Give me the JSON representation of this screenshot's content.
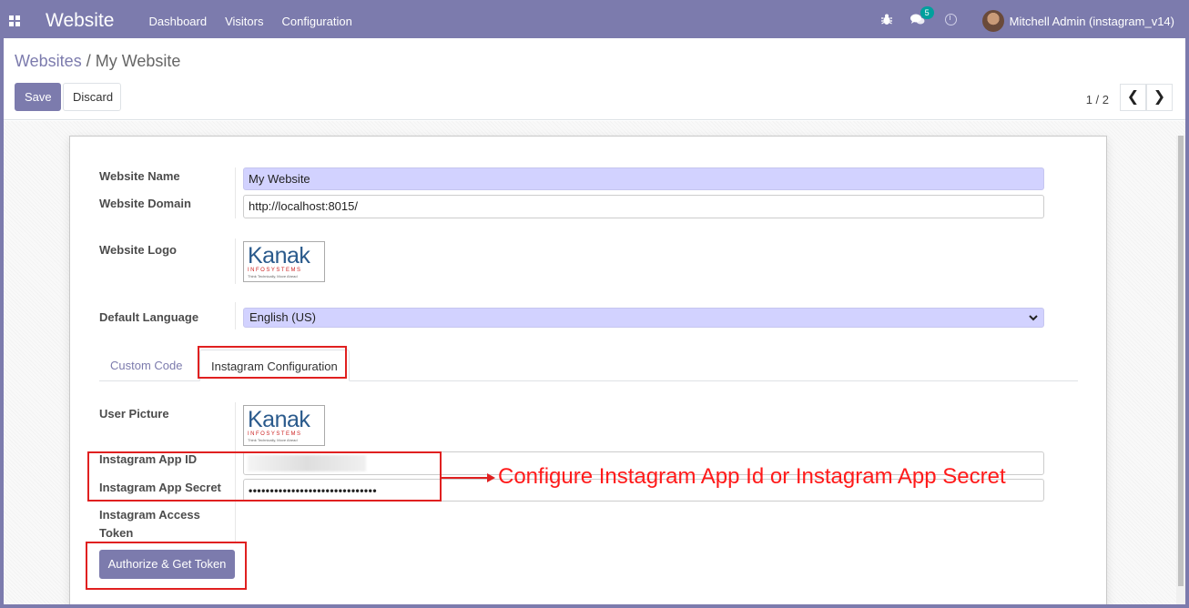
{
  "navbar": {
    "brand": "Website",
    "menu": [
      "Dashboard",
      "Visitors",
      "Configuration"
    ],
    "messages_badge": "5",
    "user": "Mitchell Admin (instagram_v14)"
  },
  "breadcrumb": {
    "parent": "Websites",
    "separator": "/",
    "current": "My Website"
  },
  "actions": {
    "save": "Save",
    "discard": "Discard"
  },
  "pager": {
    "value": "1 / 2",
    "prev": "❮",
    "next": "❯"
  },
  "form": {
    "website_name_label": "Website Name",
    "website_name": "My Website",
    "website_domain_label": "Website Domain",
    "website_domain": "http://localhost:8015/",
    "website_logo_label": "Website Logo",
    "default_language_label": "Default Language",
    "default_language": "English (US)"
  },
  "logo": {
    "name": "Kanak",
    "sub": "INFOSYSTEMS",
    "tagline": "Think Technically, Move Ahead"
  },
  "tabs": {
    "custom_code": "Custom Code",
    "instagram_configuration": "Instagram Configuration"
  },
  "instagram": {
    "user_picture_label": "User Picture",
    "app_id_label": "Instagram App ID",
    "app_secret_label": "Instagram App Secret",
    "app_secret_value": "••••••••••••••••••••••••••••••",
    "access_token_label_1": "Instagram Access",
    "access_token_label_2": "Token",
    "authorize_button": "Authorize & Get Token"
  },
  "annotation": "Configure Instagram App Id or Instagram App Secret",
  "colors": {
    "primary": "#7c7bad",
    "required_field": "#d2d2ff",
    "annotation_red": "#e02020"
  }
}
